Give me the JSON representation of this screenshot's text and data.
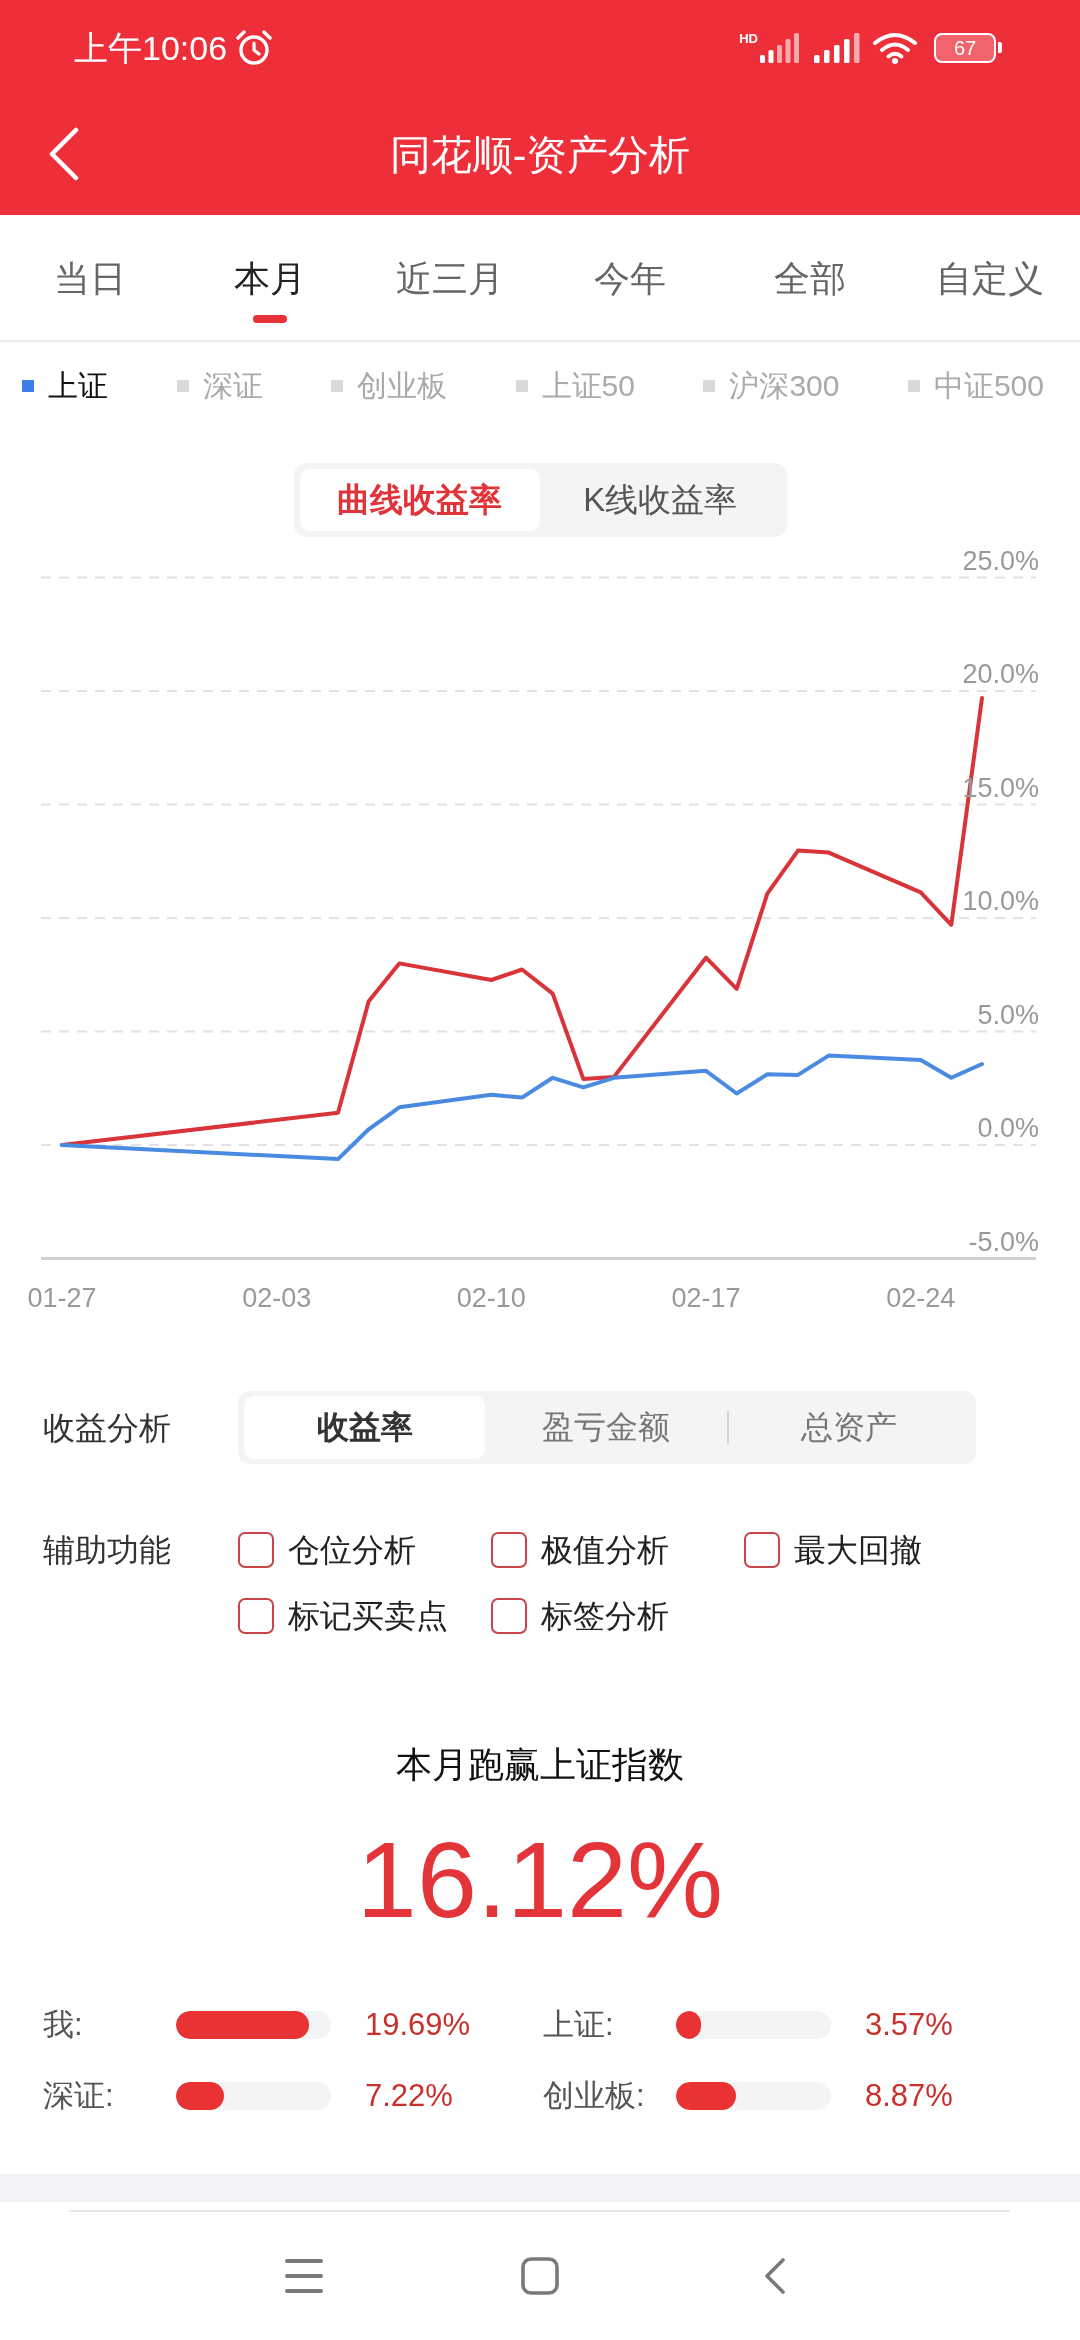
{
  "status_bar": {
    "time": "上午10:06",
    "network_type": "HD",
    "battery": "67"
  },
  "header": {
    "title": "同花顺-资产分析"
  },
  "period_tabs": [
    {
      "label": "当日",
      "selected": false
    },
    {
      "label": "本月",
      "selected": true
    },
    {
      "label": "近三月",
      "selected": false
    },
    {
      "label": "今年",
      "selected": false
    },
    {
      "label": "全部",
      "selected": false
    },
    {
      "label": "自定义",
      "selected": false
    }
  ],
  "index_legend": [
    {
      "label": "上证",
      "selected": true,
      "color": "#3d7fe6"
    },
    {
      "label": "深证",
      "selected": false,
      "color": "#d9d9d9"
    },
    {
      "label": "创业板",
      "selected": false,
      "color": "#d9d9d9"
    },
    {
      "label": "上证50",
      "selected": false,
      "color": "#d9d9d9"
    },
    {
      "label": "沪深300",
      "selected": false,
      "color": "#d9d9d9"
    },
    {
      "label": "中证500",
      "selected": false,
      "color": "#d9d9d9"
    }
  ],
  "chart_mode_toggle": [
    {
      "label": "曲线收益率",
      "selected": true
    },
    {
      "label": "K线收益率",
      "selected": false
    }
  ],
  "return_chart": {
    "chart_data": {
      "type": "line",
      "grid": true,
      "categories": [
        "01-27",
        null,
        null,
        null,
        null,
        null,
        null,
        "02-03",
        null,
        null,
        null,
        null,
        null,
        null,
        "02-10",
        null,
        null,
        null,
        null,
        null,
        null,
        "02-17",
        null,
        null,
        null,
        null,
        null,
        null,
        "02-24",
        null,
        null
      ],
      "series": [
        {
          "color": "#d8343a",
          "values": [
            0,
            null,
            null,
            null,
            null,
            null,
            null,
            null,
            null,
            1.42,
            6.33,
            8.0,
            null,
            null,
            7.27,
            7.73,
            6.67,
            2.91,
            3.0,
            null,
            null,
            8.25,
            6.88,
            11.07,
            12.97,
            12.88,
            null,
            null,
            11.13,
            9.7,
            19.69
          ]
        },
        {
          "color": "#4a8ae0",
          "values": [
            0,
            null,
            null,
            null,
            null,
            null,
            null,
            null,
            null,
            -0.62,
            0.69,
            1.66,
            null,
            null,
            2.21,
            2.09,
            2.96,
            2.54,
            2.96,
            null,
            null,
            3.27,
            2.27,
            3.12,
            3.09,
            3.94,
            null,
            null,
            3.75,
            2.96,
            3.57
          ]
        }
      ],
      "ylim": [
        -5,
        25
      ],
      "yticks": [
        {
          "value": -5,
          "label": "-5.0%"
        },
        {
          "value": 0,
          "label": "0.0%"
        },
        {
          "value": 5,
          "label": "5.0%"
        },
        {
          "value": 10,
          "label": "10.0%"
        },
        {
          "value": 15,
          "label": "15.0%"
        },
        {
          "value": 20,
          "label": "20.0%"
        },
        {
          "value": 25,
          "label": "25.0%"
        }
      ]
    }
  },
  "return_analysis": {
    "label": "收益分析",
    "options": [
      {
        "label": "收益率",
        "selected": true
      },
      {
        "label": "盈亏金额",
        "selected": false
      },
      {
        "label": "总资产",
        "selected": false
      }
    ]
  },
  "aux_functions": {
    "label": "辅助功能",
    "options": [
      {
        "label": "仓位分析",
        "checked": false
      },
      {
        "label": "极值分析",
        "checked": false
      },
      {
        "label": "最大回撤",
        "checked": false
      },
      {
        "label": "标记买卖点",
        "checked": false
      },
      {
        "label": "标签分析",
        "checked": false
      }
    ]
  },
  "summary": {
    "title": "本月跑赢上证指数",
    "value": "16.12%",
    "comparisons": [
      {
        "label": "我:",
        "level": 0.86,
        "value": "19.69%"
      },
      {
        "label": "上证:",
        "level": 0.16,
        "value": "3.57%"
      },
      {
        "label": "深证:",
        "level": 0.31,
        "value": "7.22%"
      },
      {
        "label": "创业板:",
        "level": 0.39,
        "value": "8.87%"
      }
    ]
  }
}
